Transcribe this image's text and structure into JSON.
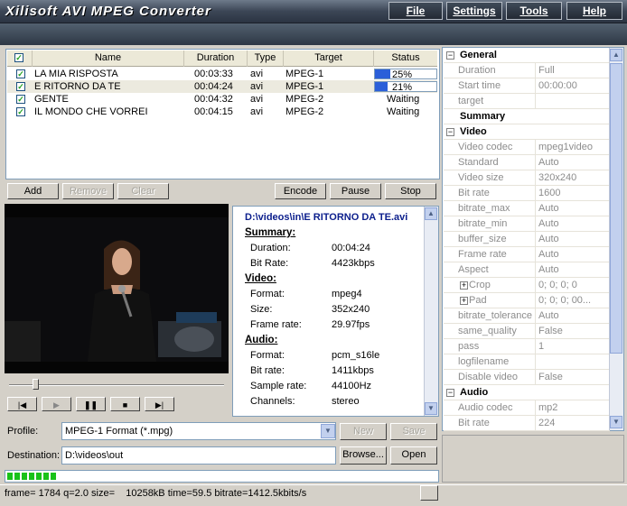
{
  "app": {
    "title": "Xilisoft AVI MPEG Converter"
  },
  "menu": {
    "file": "File",
    "settings": "Settings",
    "tools": "Tools",
    "help": "Help"
  },
  "table": {
    "headers": {
      "name": "Name",
      "duration": "Duration",
      "type": "Type",
      "target": "Target",
      "status": "Status"
    },
    "rows": [
      {
        "name": "LA MIA RISPOSTA",
        "duration": "00:03:33",
        "type": "avi",
        "target": "MPEG-1",
        "status": "25%",
        "progress": 0.25
      },
      {
        "name": "E RITORNO DA TE",
        "duration": "00:04:24",
        "type": "avi",
        "target": "MPEG-1",
        "status": "21%",
        "progress": 0.21
      },
      {
        "name": "GENTE",
        "duration": "00:04:32",
        "type": "avi",
        "target": "MPEG-2",
        "status": "Waiting"
      },
      {
        "name": "IL MONDO CHE VORREI",
        "duration": "00:04:15",
        "type": "avi",
        "target": "MPEG-2",
        "status": "Waiting"
      }
    ]
  },
  "actions": {
    "add": "Add",
    "remove": "Remove",
    "clear": "Clear",
    "encode": "Encode",
    "pause": "Pause",
    "stop": "Stop"
  },
  "info": {
    "path": "D:\\videos\\in\\E RITORNO DA TE.avi",
    "summary_h": "Summary:",
    "duration_l": "Duration:",
    "duration_v": "00:04:24",
    "bitrate_l": "Bit Rate:",
    "bitrate_v": "4423kbps",
    "video_h": "Video:",
    "format_l": "Format:",
    "format_v": "mpeg4",
    "size_l": "Size:",
    "size_v": "352x240",
    "framerate_l": "Frame rate:",
    "framerate_v": "29.97fps",
    "audio_h": "Audio:",
    "aformat_l": "Format:",
    "aformat_v": "pcm_s16le",
    "abitrate_l": "Bit rate:",
    "abitrate_v": "1411kbps",
    "sample_l": "Sample rate:",
    "sample_v": "44100Hz",
    "channels_l": "Channels:",
    "channels_v": "stereo"
  },
  "bottom": {
    "profile_label": "Profile:",
    "profile_value": "MPEG-1 Format  (*.mpg)",
    "new": "New",
    "save": "Save",
    "destination_label": "Destination:",
    "destination_value": "D:\\videos\\out",
    "browse": "Browse...",
    "open": "Open"
  },
  "status": {
    "text": "frame= 1784 q=2.0 size=    10258kB time=59.5 bitrate=1412.5kbits/s"
  },
  "props": [
    {
      "kind": "section",
      "label": "General",
      "box": "−"
    },
    {
      "kind": "item",
      "key": "Duration",
      "value": "Full"
    },
    {
      "kind": "item",
      "key": "Start time",
      "value": "00:00:00"
    },
    {
      "kind": "item",
      "key": "target",
      "value": ""
    },
    {
      "kind": "plain",
      "label": "Summary"
    },
    {
      "kind": "section",
      "label": "Video",
      "box": "−"
    },
    {
      "kind": "item",
      "key": "Video codec",
      "value": "mpeg1video"
    },
    {
      "kind": "item",
      "key": "Standard",
      "value": "Auto"
    },
    {
      "kind": "item",
      "key": "Video size",
      "value": "320x240"
    },
    {
      "kind": "item",
      "key": "Bit rate",
      "value": "1600"
    },
    {
      "kind": "item",
      "key": "bitrate_max",
      "value": "Auto"
    },
    {
      "kind": "item",
      "key": "bitrate_min",
      "value": "Auto"
    },
    {
      "kind": "item",
      "key": "buffer_size",
      "value": "Auto"
    },
    {
      "kind": "item",
      "key": "Frame rate",
      "value": "Auto"
    },
    {
      "kind": "item",
      "key": "Aspect",
      "value": "Auto"
    },
    {
      "kind": "subitem",
      "key": "Crop",
      "value": "0; 0; 0; 0",
      "box": "+"
    },
    {
      "kind": "subitem",
      "key": "Pad",
      "value": "0; 0; 0; 00...",
      "box": "+"
    },
    {
      "kind": "item",
      "key": "bitrate_tolerance",
      "value": "Auto"
    },
    {
      "kind": "item",
      "key": "same_quality",
      "value": "False"
    },
    {
      "kind": "item",
      "key": "pass",
      "value": "1"
    },
    {
      "kind": "item",
      "key": "logfilename",
      "value": ""
    },
    {
      "kind": "item",
      "key": "Disable video",
      "value": "False"
    },
    {
      "kind": "section",
      "label": "Audio",
      "box": "−"
    },
    {
      "kind": "item",
      "key": "Audio codec",
      "value": "mp2"
    },
    {
      "kind": "item",
      "key": "Bit rate",
      "value": "224"
    }
  ],
  "player": {
    "seek_position": 0.12,
    "progress_blocks": 7
  },
  "icons": {
    "play": "play-icon",
    "pause": "pause-icon",
    "stop": "stop-icon",
    "prev": "prev-icon",
    "next": "next-icon",
    "dropdown": "chevron-down-icon"
  },
  "colors": {
    "accent": "#2b5fd9",
    "title_dark": "#2e3845",
    "info_path": "#0b1e8c",
    "progress_green": "#19c219"
  }
}
